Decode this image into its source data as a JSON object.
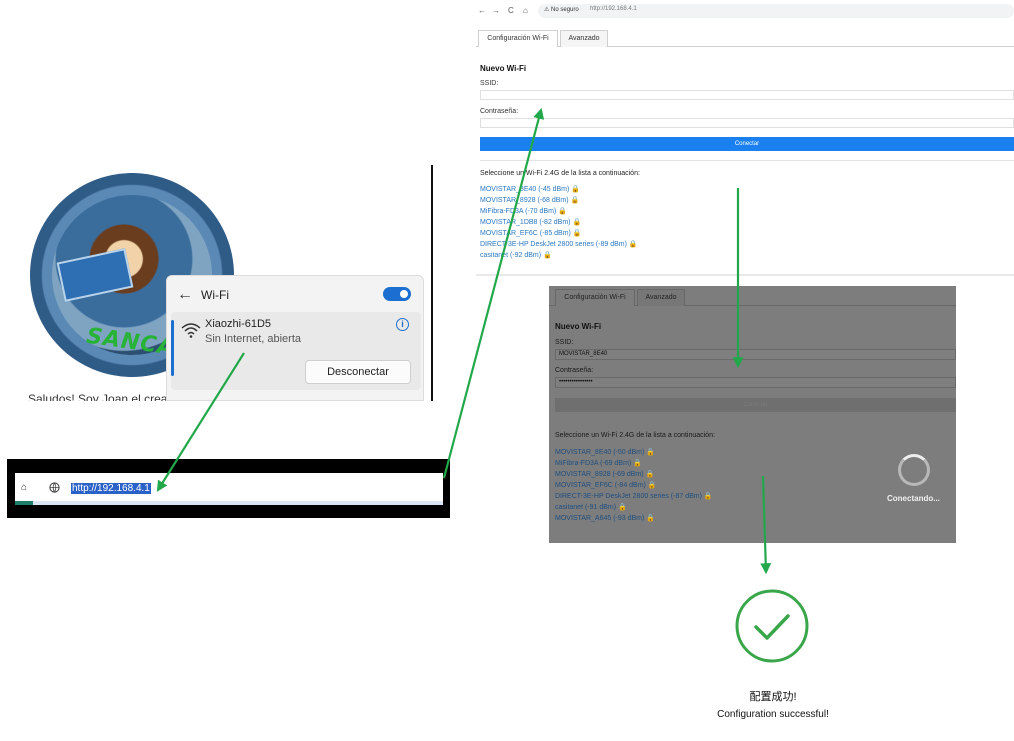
{
  "left_panel": {
    "avatar_text": "SANCAR",
    "greeting": "Saludos! Soy Joan el crea"
  },
  "wifi_flyout": {
    "back_glyph": "←",
    "title": "Wi-Fi",
    "toggle_on": true,
    "network_name": "Xiaozhi-61D5",
    "network_status": "Sin Internet, abierta",
    "info_glyph": "i",
    "disconnect_label": "Desconectar"
  },
  "address_snippet": {
    "home_glyph": "⌂",
    "url": "http://192.168.4.1"
  },
  "browser_top": {
    "nav": {
      "back": "←",
      "forward": "→",
      "reload": "C",
      "home": "⌂"
    },
    "warning": "⚠ No seguro",
    "url": "http://192.168.4.1",
    "tabs": [
      "Configuración Wi-Fi",
      "Avanzado"
    ],
    "form_title": "Nuevo Wi-Fi",
    "ssid_label": "SSID:",
    "password_label": "Contraseña:",
    "connect_label": "Conectar",
    "select_prompt": "Seleccione un Wi-Fi 2.4G de la lista a continuación:",
    "networks": [
      "MOVISTAR_8E40 (-45 dBm)",
      "MOVISTAR_8928 (-68 dBm)",
      "MiFibra-FD3A (-70 dBm)",
      "MOVISTAR_1DB8 (-82 dBm)",
      "MOVISTAR_EF6C (-85 dBm)",
      "DIRECT-3E-HP DeskJet 2800 series (-89 dBm)",
      "casitanet (-92 dBm)"
    ]
  },
  "browser_mid": {
    "tabs": [
      "Configuración Wi-Fi",
      "Avanzado"
    ],
    "form_title": "Nuevo Wi-Fi",
    "ssid_label": "SSID:",
    "ssid_value": "MOVISTAR_8E40",
    "password_label": "Contraseña:",
    "password_value": "••••••••••••••••",
    "connect_label": "Conectar",
    "select_prompt": "Seleccione un Wi-Fi 2.4G de la lista a continuación:",
    "networks": [
      "MOVISTAR_8E40 (-50 dBm)",
      "MiFibra-FD3A (-69 dBm)",
      "MOVISTAR_8928 (-69 dBm)",
      "MOVISTAR_EF6C (-84 dBm)",
      "DIRECT-3E-HP DeskJet 2800 series (-87 dBm)",
      "casitanet (-91 dBm)",
      "MOVISTAR_A645 (-93 dBm)"
    ],
    "connecting_text": "Conectando..."
  },
  "success": {
    "title_cn": "配置成功!",
    "title_en": "Configuration successful!"
  },
  "colors": {
    "arrow_green": "#22a84a",
    "connect_blue": "#1a80f0",
    "toggle_blue": "#1c6fd1",
    "link_blue": "#2a78c2",
    "success_green": "#3aa64a"
  },
  "icons": {
    "lock": "lock-icon",
    "wifi": "wifi-signal-icon",
    "globe": "globe-icon",
    "check": "check-circle-icon"
  }
}
